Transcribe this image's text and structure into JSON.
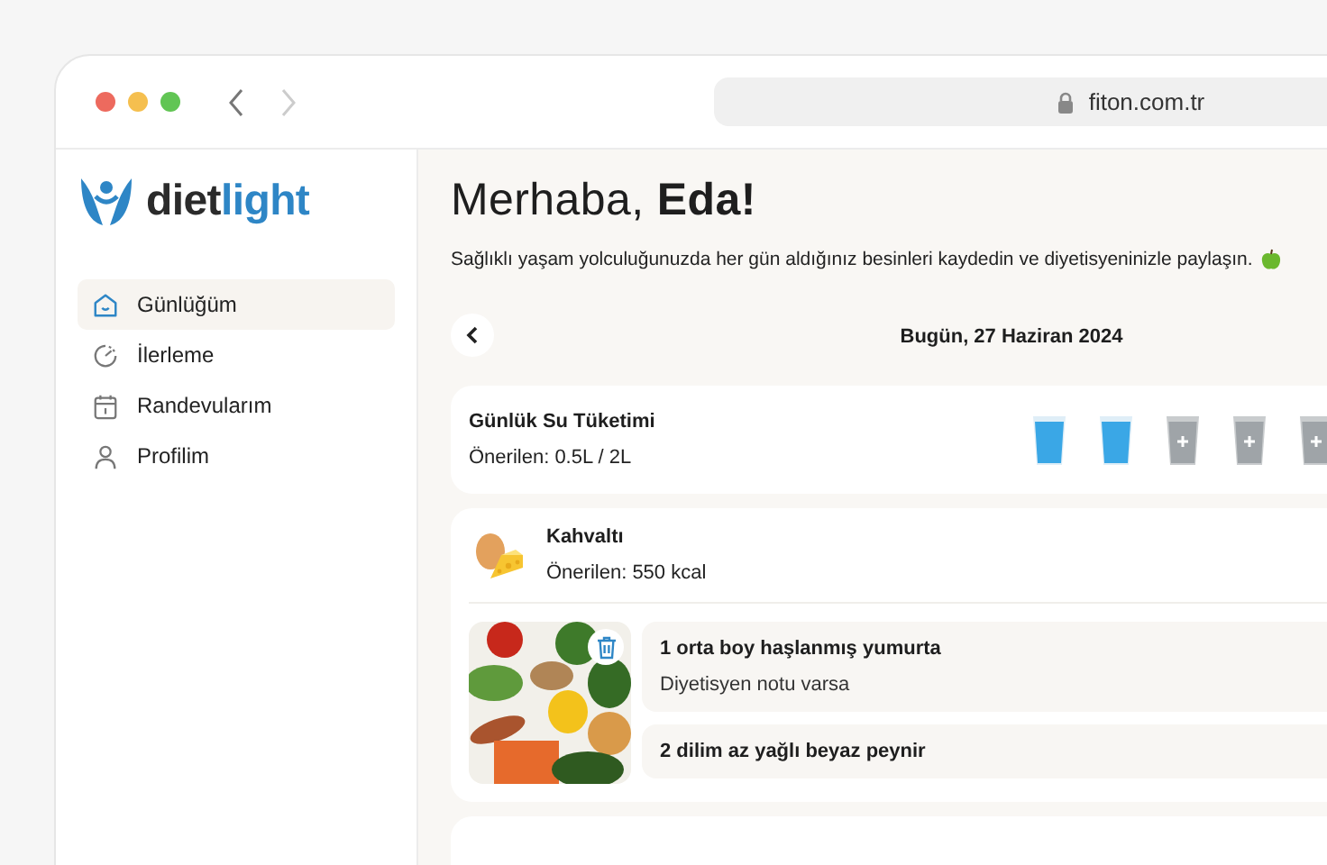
{
  "browser": {
    "url": "fiton.com.tr"
  },
  "logo": {
    "main": "diet",
    "accent": "light"
  },
  "sidebar": {
    "items": [
      {
        "label": "Günlüğüm",
        "kind": "home",
        "selected": true
      },
      {
        "label": "İlerleme",
        "kind": "progress",
        "selected": false
      },
      {
        "label": "Randevularım",
        "kind": "calendar",
        "selected": false
      },
      {
        "label": "Profilim",
        "kind": "profile",
        "selected": false
      }
    ]
  },
  "greeting": "Merhaba, **Eda!**",
  "intro": "Sağlıklı yaşam yolculuğunuzda her gün aldığınız besinleri kaydedin ve diyetisyeninizle paylaşın.",
  "date": "Bugün, 27 Haziran 2024",
  "water": {
    "title": "Günlük Su Tüketimi",
    "recommended": "Önerilen: 0.5L / 2L",
    "glasses": [
      {
        "filled": true
      },
      {
        "filled": true
      },
      {
        "filled": false
      },
      {
        "filled": false
      },
      {
        "filled": false
      }
    ]
  },
  "meals": [
    {
      "title": "Kahvaltı",
      "recommended": "Önerilen: 550 kcal",
      "items": [
        {
          "name": "1 orta boy haşlanmış yumurta",
          "note": "Diyetisyen notu varsa"
        },
        {
          "name": "2 dilim az yağlı beyaz peynir"
        }
      ]
    }
  ]
}
